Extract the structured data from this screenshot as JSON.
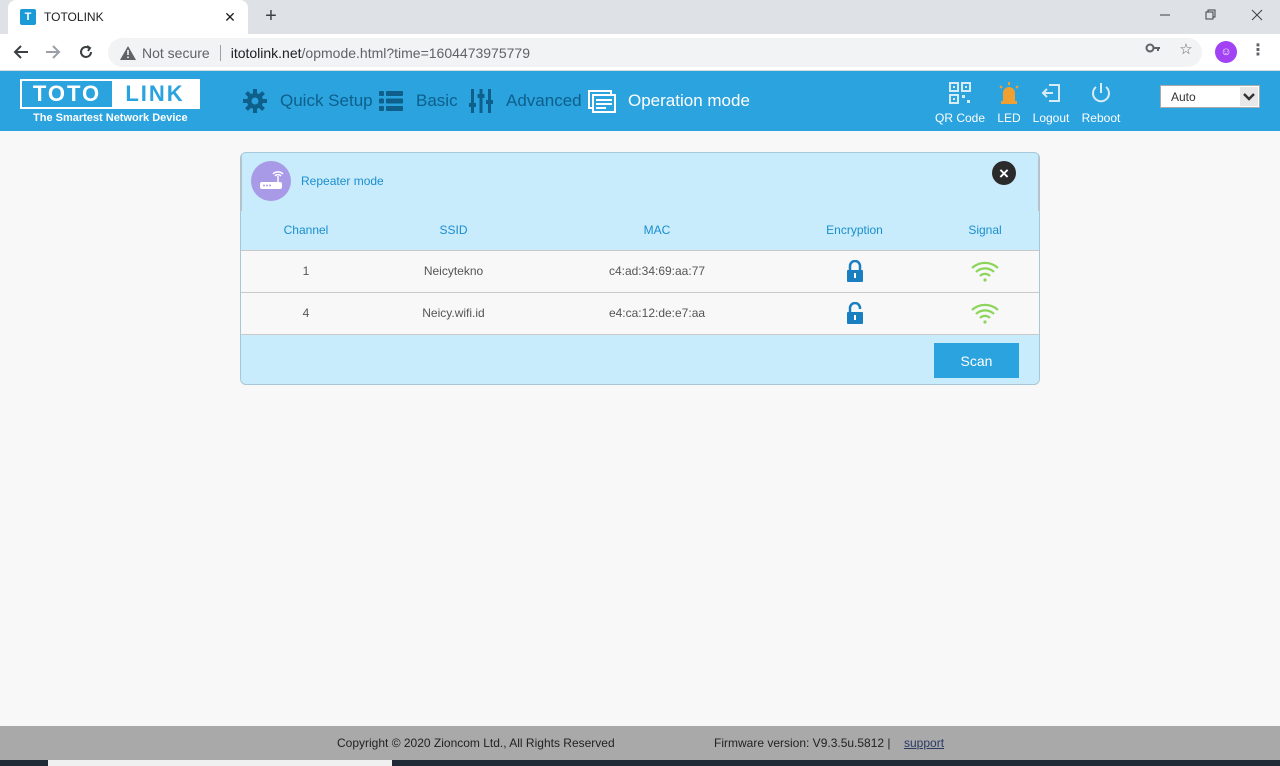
{
  "browser": {
    "tab_title": "TOTOLINK",
    "favicon_letter": "T",
    "new_tab": "+",
    "close_tab": "✕",
    "security": "Not secure",
    "url_host": "itotolink.net",
    "url_path": "/opmode.html?time=1604473975779"
  },
  "router": {
    "logo_left": "TOTO",
    "logo_right": "LINK",
    "tagline": "The Smartest Network Device",
    "menu": [
      {
        "label": "Quick Setup",
        "icon": "gear-icon"
      },
      {
        "label": "Basic",
        "icon": "list-icon"
      },
      {
        "label": "Advanced",
        "icon": "sliders-icon"
      },
      {
        "label": "Operation mode",
        "icon": "operation-mode-icon"
      }
    ],
    "tools": {
      "qr": "QR Code",
      "led": "LED",
      "logout": "Logout",
      "reboot": "Reboot"
    },
    "language": "Auto"
  },
  "panel": {
    "title": "Repeater mode",
    "columns": [
      "Channel",
      "SSID",
      "MAC",
      "Encryption",
      "Signal"
    ],
    "rows": [
      {
        "channel": "1",
        "ssid": "Neicytekno",
        "mac": "c4:ad:34:69:aa:77",
        "encryption": "locked",
        "signal": "strong"
      },
      {
        "channel": "4",
        "ssid": "Neicy.wifi.id",
        "mac": "e4:ca:12:de:e7:aa",
        "encryption": "open",
        "signal": "strong"
      }
    ],
    "scan_label": "Scan"
  },
  "footer": {
    "copyright": "Copyright © 2020 Zioncom Ltd., All Rights Reserved",
    "firmware": "Firmware version: V9.3.5u.5812  |",
    "support": "support"
  },
  "colors": {
    "brand": "#2aa3df",
    "panel_bg": "#c8ecfb",
    "signal_green": "#8bd65a",
    "lock_blue": "#1a7fc1"
  }
}
